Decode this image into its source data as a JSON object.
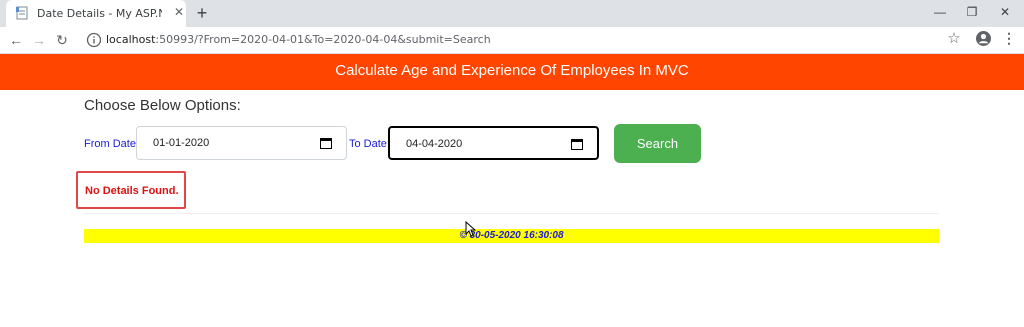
{
  "browser": {
    "tab_title": "Date Details - My ASP.NET Applic",
    "url_host": "localhost",
    "url_rest": ":50993/?From=2020-04-01&To=2020-04-04&submit=Search"
  },
  "page": {
    "banner_title": "Calculate Age and Experience Of Employees In MVC",
    "choose_label": "Choose Below Options:",
    "from_label": "From Date:",
    "from_value": "01-01-2020",
    "to_label": "To Date:",
    "to_value": "04-04-2020",
    "search_label": "Search",
    "no_details": "No Details Found.",
    "footer": "© 30-05-2020 16:30:08"
  },
  "colors": {
    "banner": "#ff4500",
    "search_button": "#4caf50",
    "footer_bar": "#ffff00",
    "error_text": "#dd1111",
    "label_text": "#1b1bd8"
  },
  "icons": {
    "favicon": "document-icon",
    "close": "close-icon",
    "new_tab": "plus-icon",
    "back": "arrow-left-icon",
    "forward": "arrow-right-icon",
    "reload": "reload-icon",
    "info": "info-icon",
    "bookmark": "star-icon",
    "profile": "account-icon",
    "menu": "kebab-menu-icon",
    "calendar": "calendar-icon"
  }
}
